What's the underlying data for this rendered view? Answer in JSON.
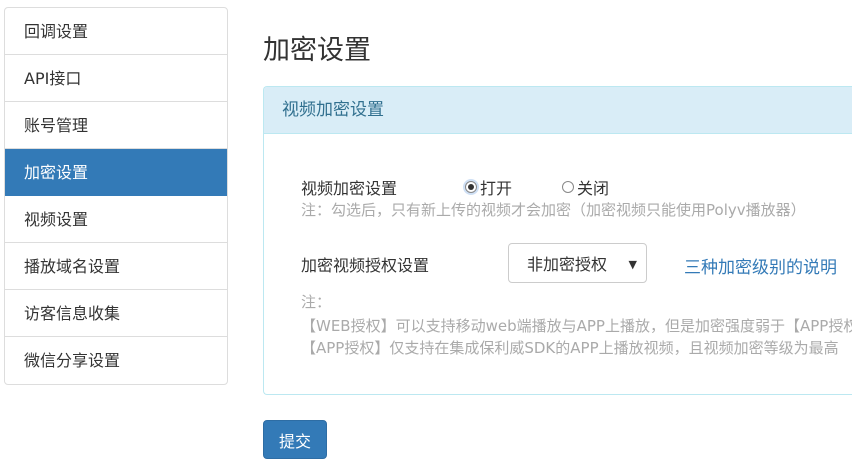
{
  "sidebar": {
    "items": [
      {
        "label": "回调设置"
      },
      {
        "label": "API接口"
      },
      {
        "label": "账号管理"
      },
      {
        "label": "加密设置",
        "active": true
      },
      {
        "label": "视频设置"
      },
      {
        "label": "播放域名设置"
      },
      {
        "label": "访客信息收集"
      },
      {
        "label": "微信分享设置"
      }
    ]
  },
  "page": {
    "title": "加密设置"
  },
  "panel": {
    "heading": "视频加密设置",
    "encryption": {
      "label": "视频加密设置",
      "option_on": "打开",
      "option_off": "关闭",
      "selected": "打开",
      "note": "注：勾选后，只有新上传的视频才会加密（加密视频只能使用Polyv播放器）"
    },
    "auth": {
      "label": "加密视频授权设置",
      "select_value": "非加密授权",
      "help_link": "三种加密级别的说明",
      "note_title": "注：",
      "note_web": "【WEB授权】可以支持移动web端播放与APP上播放，但是加密强度弱于【APP授权】",
      "note_app": "【APP授权】仅支持在集成保利威SDK的APP上播放视频，且视频加密等级为最高"
    }
  },
  "actions": {
    "submit_label": "提交"
  },
  "colors": {
    "primary": "#337ab7",
    "panel_header_bg": "#d9edf7",
    "panel_header_text": "#31708f"
  }
}
